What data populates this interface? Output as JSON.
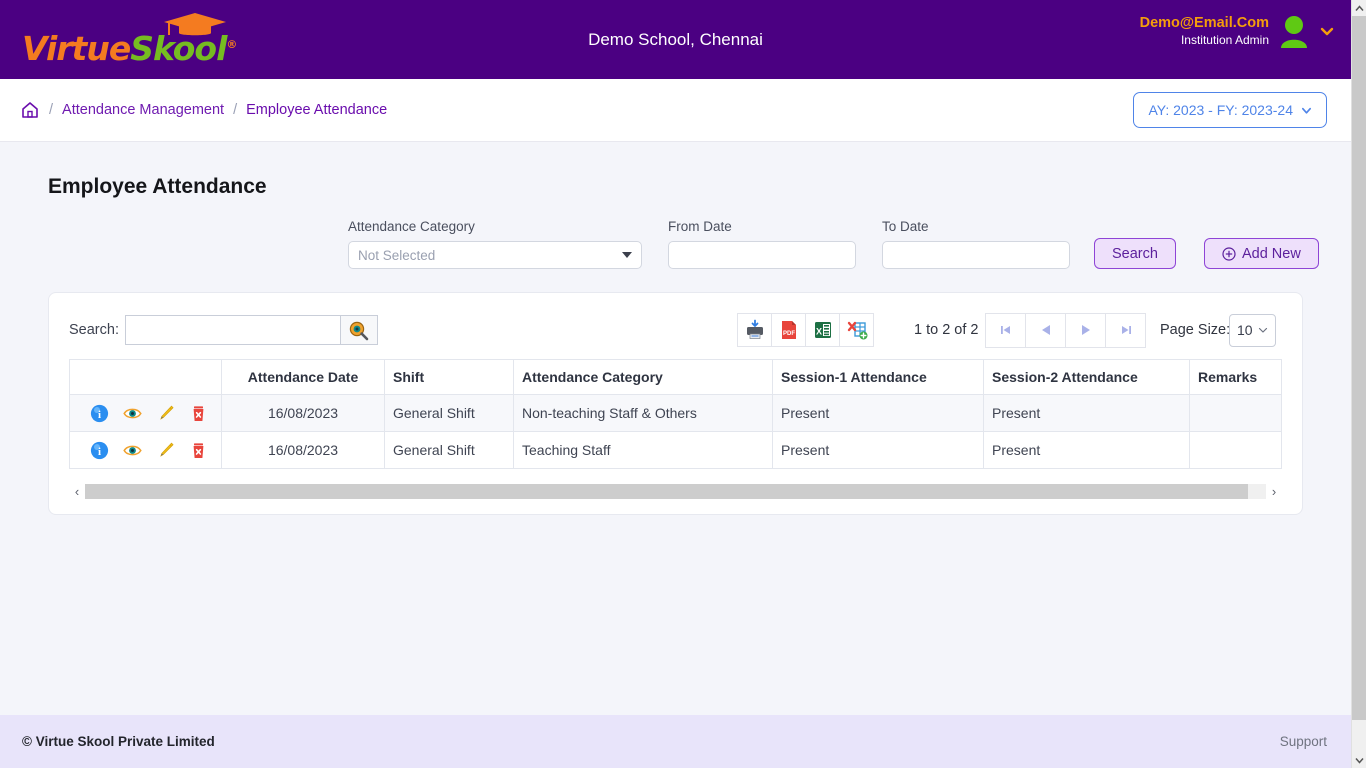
{
  "header": {
    "logo": {
      "part1": "Virtue",
      "part2": "Skool",
      "registered": "®",
      "cap_icon": "graduation-cap-icon"
    },
    "school_title": "Demo School, Chennai",
    "user_email": "Demo@Email.Com",
    "user_role": "Institution Admin",
    "avatar_icon": "user-avatar-icon",
    "caret_icon": "chevron-down-icon",
    "colors": {
      "bar": "#4b0082",
      "email": "#f59e0b",
      "logo_orange": "#f47b20",
      "logo_green": "#76bc21"
    }
  },
  "breadcrumb": {
    "home_icon": "home-icon",
    "sep": "/",
    "items": [
      {
        "label": "Attendance Management"
      },
      {
        "label": "Employee Attendance"
      }
    ],
    "ay_button": {
      "label": "AY: 2023 - FY: 2023-24",
      "caret_icon": "chevron-down-icon",
      "color": "#4f84e8"
    }
  },
  "page": {
    "title": "Employee Attendance"
  },
  "filters": {
    "attendance_category": {
      "label": "Attendance Category",
      "value": "Not Selected",
      "caret_icon": "caret-down-icon"
    },
    "from_date": {
      "label": "From Date",
      "value": "",
      "placeholder": ""
    },
    "to_date": {
      "label": "To Date",
      "value": "",
      "placeholder": ""
    },
    "search_button": "Search",
    "add_new_button": "Add New",
    "add_new_icon": "plus-circle-icon"
  },
  "grid": {
    "search_label": "Search:",
    "search_value": "",
    "search_placeholder": "",
    "search_icon": "magnifier-icon",
    "exports": [
      {
        "name": "print-export-button",
        "icon": "printer-icon",
        "label": ""
      },
      {
        "name": "pdf-export-button",
        "icon": "pdf-icon",
        "label": "PDF"
      },
      {
        "name": "excel-export-button",
        "icon": "excel-icon",
        "label": "X"
      },
      {
        "name": "xml-export-button",
        "icon": "xml-export-icon",
        "label": ""
      }
    ],
    "range_text": "1 to 2 of 2",
    "pager": [
      {
        "name": "first-page-button",
        "icon": "first-page-icon"
      },
      {
        "name": "prev-page-button",
        "icon": "prev-page-icon"
      },
      {
        "name": "next-page-button",
        "icon": "next-page-icon"
      },
      {
        "name": "last-page-button",
        "icon": "last-page-icon"
      }
    ],
    "page_size_label": "Page Size:",
    "page_size_value": "10",
    "page_size_caret": "chevron-down-icon",
    "columns": [
      "",
      "Attendance Date",
      "Shift",
      "Attendance Category",
      "Session-1 Attendance",
      "Session-2 Attendance",
      "Remarks"
    ],
    "row_action_icons": [
      "info-icon",
      "view-eye-icon",
      "edit-pencil-icon",
      "delete-icon"
    ],
    "rows": [
      {
        "date": "16/08/2023",
        "shift": "General Shift",
        "category": "Non-teaching Staff & Others",
        "session1": "Present",
        "session2": "Present",
        "remarks": ""
      },
      {
        "date": "16/08/2023",
        "shift": "General Shift",
        "category": "Teaching Staff",
        "session1": "Present",
        "session2": "Present",
        "remarks": ""
      }
    ],
    "hscroll": {
      "left_arrow": "‹",
      "right_arrow": "›"
    }
  },
  "footer": {
    "copyright": "© Virtue Skool Private Limited",
    "support": "Support"
  }
}
